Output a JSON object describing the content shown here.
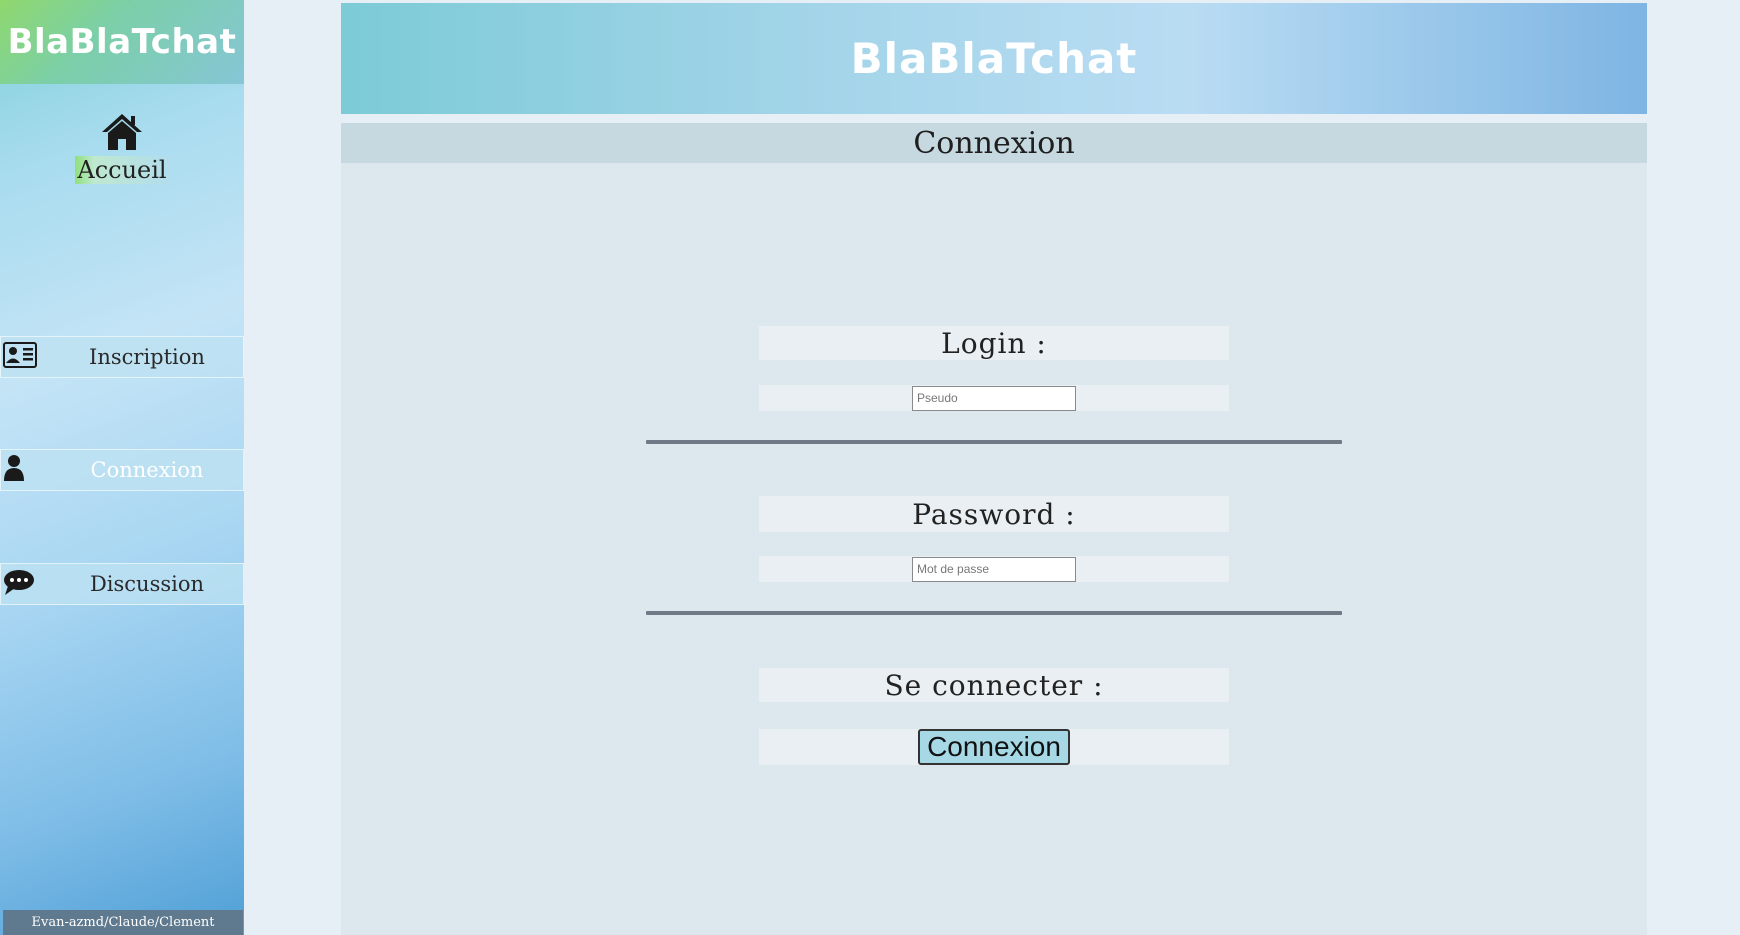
{
  "app": {
    "brand": "BlaBlaTchat"
  },
  "sidebar": {
    "home_label": "Accueil",
    "items": [
      {
        "label": "Inscription",
        "icon": "id-card-icon"
      },
      {
        "label": "Connexion",
        "icon": "user-icon",
        "active": true
      },
      {
        "label": "Discussion",
        "icon": "chat-bubble-icon"
      }
    ],
    "footer": "Evan-azmd/Claude/Clement"
  },
  "header": {
    "title": "BlaBlaTchat"
  },
  "form": {
    "title": "Connexion",
    "login_label": "Login :",
    "login_placeholder": "Pseudo",
    "login_value": "",
    "password_label": "Password :",
    "password_placeholder": "Mot de passe",
    "password_value": "",
    "submit_label": "Se connecter :",
    "submit_button": "Connexion"
  }
}
